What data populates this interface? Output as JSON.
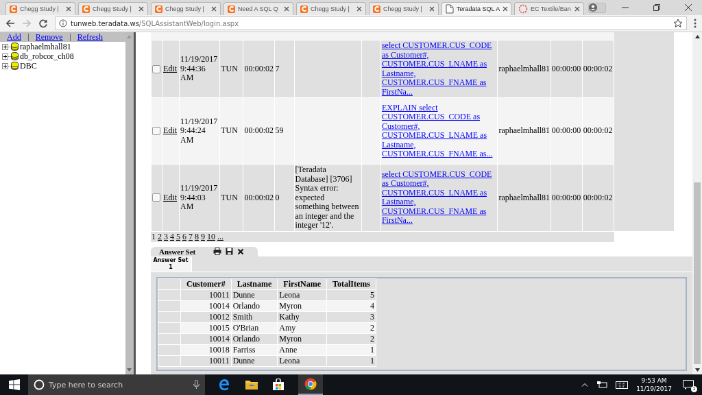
{
  "browser": {
    "tabs": [
      {
        "title": "Chegg Study |",
        "kind": "chegg",
        "selected": false
      },
      {
        "title": "Chegg Study |",
        "kind": "chegg",
        "selected": false
      },
      {
        "title": "Chegg Study |",
        "kind": "chegg",
        "selected": false
      },
      {
        "title": "Need A SQL Q",
        "kind": "chegg",
        "selected": false
      },
      {
        "title": "Chegg Study |",
        "kind": "chegg",
        "selected": false
      },
      {
        "title": "Chegg Study |",
        "kind": "chegg",
        "selected": false
      },
      {
        "title": "Teradata SQL A",
        "kind": "page",
        "selected": true
      },
      {
        "title": "EC Textile/Ban",
        "kind": "loading",
        "selected": false
      }
    ],
    "address": {
      "host": "tunweb.teradata.ws",
      "path": "/SQLAssistantWeb/login.aspx"
    }
  },
  "sidebar": {
    "actions": [
      "Add",
      "Remove",
      "Refresh"
    ],
    "databases": [
      "raphaelmhall81",
      "db_robcor_ch08",
      "DBC"
    ]
  },
  "history": {
    "rows": [
      {
        "checked": false,
        "edit": "Edit",
        "date": "11/19/2017 9:44:36 AM",
        "source": "TUN",
        "elapsed": "00:00:02",
        "count": "7",
        "error": "",
        "query": "select CUSTOMER.CUS_CODE as Customer#, CUSTOMER.CUS_LNAME as Lastname, CUSTOMER.CUS_FNAME as FirstNa...",
        "user": "raphaelmhall81",
        "time_1": "00:00:00",
        "time_2": "00:00:02"
      },
      {
        "checked": false,
        "edit": "Edit",
        "date": "11/19/2017 9:44:24 AM",
        "source": "TUN",
        "elapsed": "00:00:02",
        "count": "59",
        "error": "",
        "query": "EXPLAIN select CUSTOMER.CUS_CODE as Customer#, CUSTOMER.CUS_LNAME as Lastname, CUSTOMER.CUS_FNAME as...",
        "user": "raphaelmhall81",
        "time_1": "00:00:00",
        "time_2": "00:00:02"
      },
      {
        "checked": false,
        "edit": "Edit",
        "date": "11/19/2017 9:44:03 AM",
        "source": "TUN",
        "elapsed": "00:00:02",
        "count": "0",
        "error": "[Teradata Database] [3706] Syntax error: expected something between an integer and the integer '12'.",
        "query": "select CUSTOMER.CUS_CODE as Customer#, CUSTOMER.CUS_LNAME as Lastname, CUSTOMER.CUS_FNAME as FirstNa...",
        "user": "raphaelmhall81",
        "time_1": "00:00:00",
        "time_2": "00:00:02"
      }
    ],
    "pages": [
      {
        "label": "1",
        "selected": true
      },
      {
        "label": "2",
        "selected": false
      },
      {
        "label": "3",
        "selected": false
      },
      {
        "label": "4",
        "selected": false
      },
      {
        "label": "5",
        "selected": false
      },
      {
        "label": "6",
        "selected": false
      },
      {
        "label": "7",
        "selected": false
      },
      {
        "label": "8",
        "selected": false
      },
      {
        "label": "9",
        "selected": false
      },
      {
        "label": "10",
        "selected": false
      },
      {
        "label": "...",
        "selected": false
      }
    ]
  },
  "answer": {
    "title": "Answer Set",
    "subtab": "Answer Set 1",
    "columns": [
      "Customer#",
      "Lastname",
      "FirstName",
      "TotalItems"
    ],
    "rows": [
      [
        "10011",
        "Dunne",
        "Leona",
        "5"
      ],
      [
        "10014",
        "Orlando",
        "Myron",
        "4"
      ],
      [
        "10012",
        "Smith",
        "Kathy",
        "3"
      ],
      [
        "10015",
        "O'Brian",
        "Amy",
        "2"
      ],
      [
        "10014",
        "Orlando",
        "Myron",
        "2"
      ],
      [
        "10018",
        "Farriss",
        "Anne",
        "1"
      ],
      [
        "10011",
        "Dunne",
        "Leona",
        "1"
      ]
    ]
  },
  "taskbar": {
    "search_placeholder": "Type here to search",
    "time": "9:53 AM",
    "date": "11/19/2017",
    "notifications": "1"
  }
}
